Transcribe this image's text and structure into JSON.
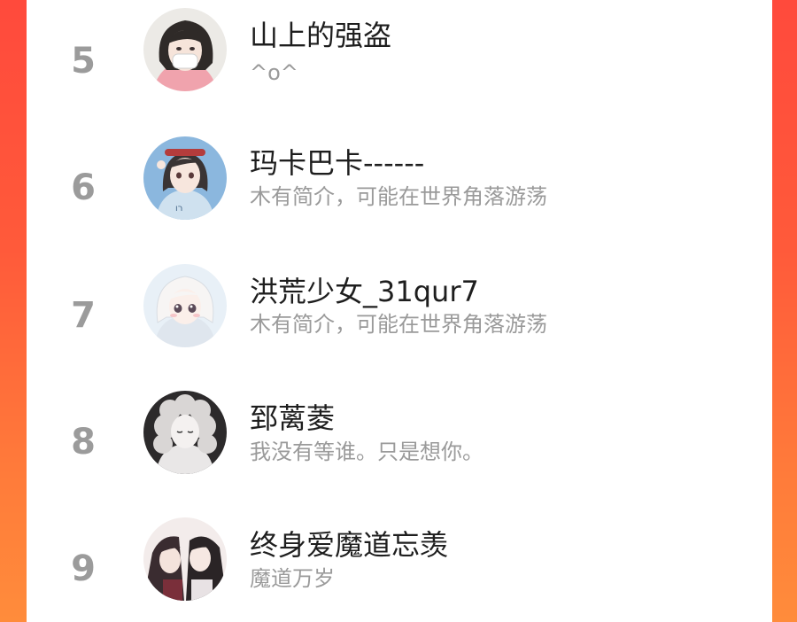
{
  "colors": {
    "background_gradient_top": "#ff4a3c",
    "background_gradient_bottom": "#ff8c3b",
    "panel": "#ffffff",
    "rank_number": "#9b9b9b",
    "name_text": "#1e1e1e",
    "bio_text": "#9a9a9a"
  },
  "ranking": {
    "items": [
      {
        "rank": "5",
        "name": "山上的强盗",
        "bio": "^o^",
        "avatar": "girl-with-mask-avatar"
      },
      {
        "rank": "6",
        "name": "玛卡巴卡------",
        "bio": "木有简介，可能在世界角落游荡",
        "avatar": "girl-waving-avatar"
      },
      {
        "rank": "7",
        "name": "洪荒少女_31qur7",
        "bio": "木有简介，可能在世界角落游荡",
        "avatar": "white-haired-girl-avatar"
      },
      {
        "rank": "8",
        "name": "郅蓠菱",
        "bio": "我没有等谁。只是想你。",
        "avatar": "sketch-curly-girl-avatar"
      },
      {
        "rank": "9",
        "name": "终身爱魔道忘羡",
        "bio": "魔道万岁",
        "avatar": "two-characters-avatar"
      }
    ]
  }
}
